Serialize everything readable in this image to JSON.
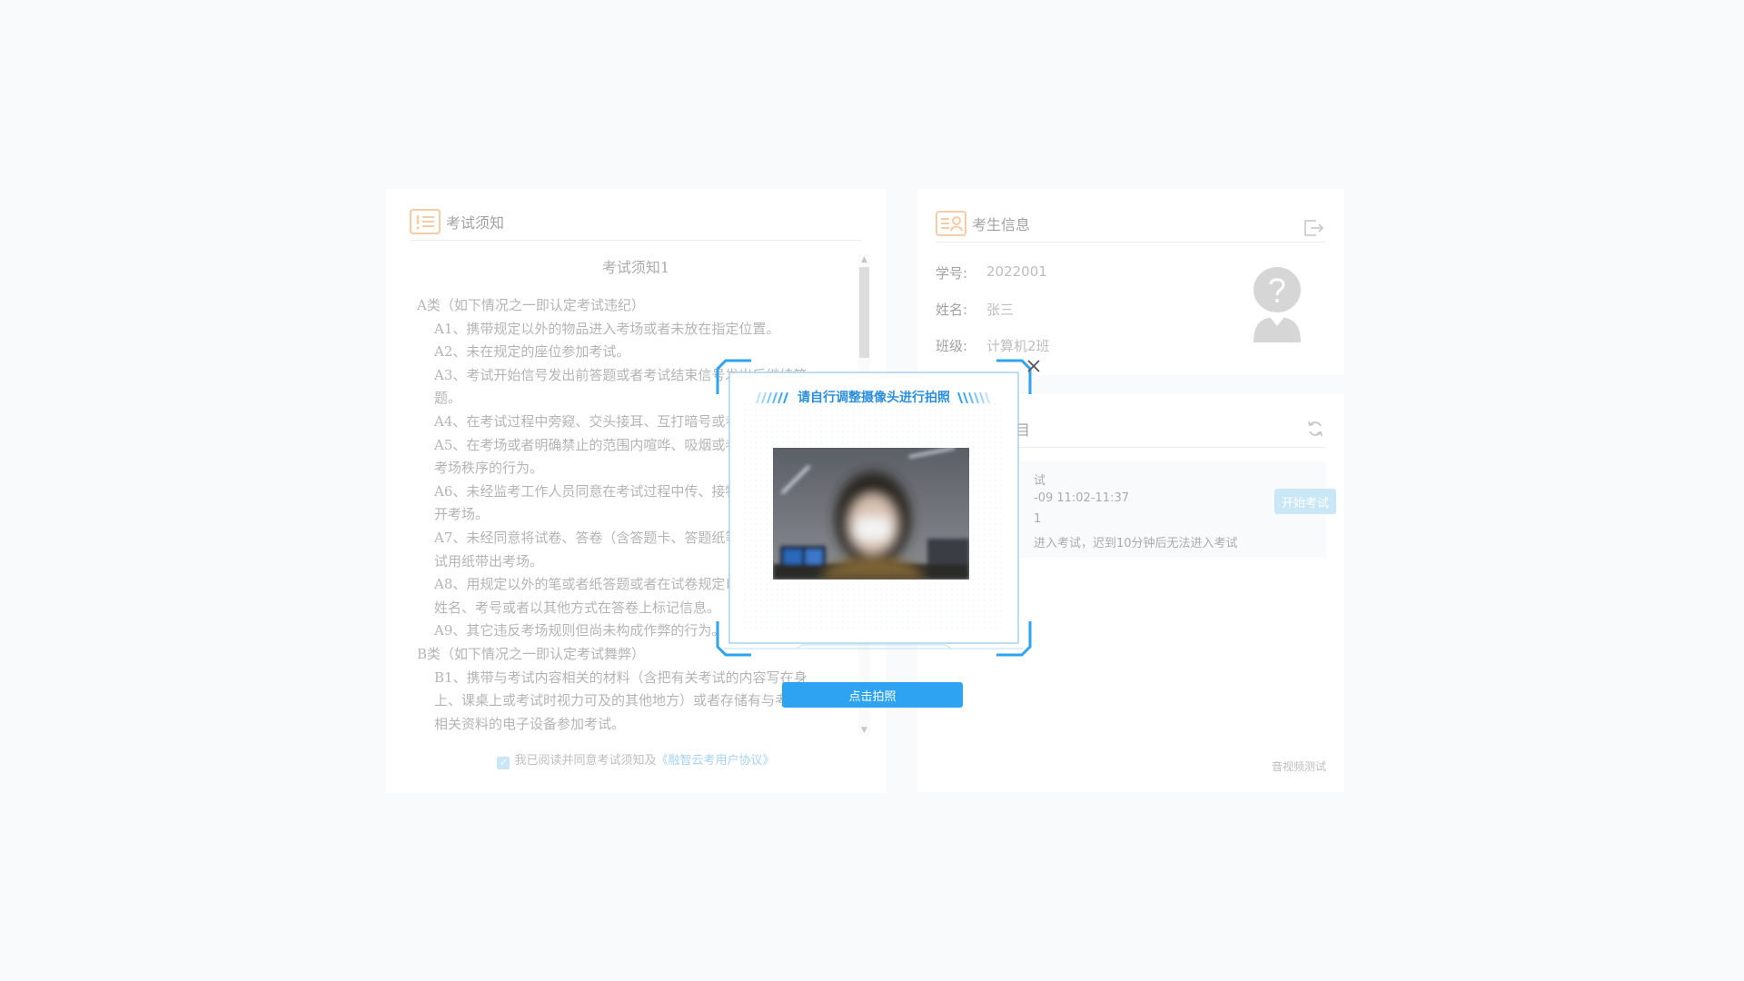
{
  "notice": {
    "header_title": "考试须知",
    "doc_title": "考试须知1",
    "lines": [
      {
        "kind": "cat",
        "text": "A类（如下情况之一即认定考试违纪）"
      },
      {
        "kind": "item",
        "text": "A1、携带规定以外的物品进入考场或者未放在指定位置。"
      },
      {
        "kind": "item",
        "text": "A2、未在规定的座位参加考试。"
      },
      {
        "kind": "item",
        "text": "A3、考试开始信号发出前答题或者考试结束信号发出后继续答题。"
      },
      {
        "kind": "item",
        "text": "A4、在考试过程中旁窥、交头接耳、互打暗号或者手势。"
      },
      {
        "kind": "item",
        "text": "A5、在考场或者明确禁止的范围内喧哗、吸烟或者实施其他影响考场秩序的行为。"
      },
      {
        "kind": "item",
        "text": "A6、未经监考工作人员同意在考试过程中传、接物品或者擅自离开考场。"
      },
      {
        "kind": "item",
        "text": "A7、未经同意将试卷、答卷（含答题卡、答题纸等）、草稿纸等考试用纸带出考场。"
      },
      {
        "kind": "item",
        "text": "A8、用规定以外的笔或者纸答题或者在试卷规定以外的地方书写姓名、考号或者以其他方式在答卷上标记信息。"
      },
      {
        "kind": "item",
        "text": "A9、其它违反考场规则但尚未构成作弊的行为。"
      },
      {
        "kind": "cat",
        "text": "B类（如下情况之一即认定考试舞弊）"
      },
      {
        "kind": "item",
        "text": "B1、携带与考试内容相关的材料（含把有关考试的内容写在身上、课桌上或考试时视力可及的其他地方）或者存储有与考试内容相关资料的电子设备参加考试。"
      }
    ],
    "agree_text": "我已阅读并同意考试须知及",
    "agree_link": "《融智云考用户协议》",
    "agree_checked": true
  },
  "student": {
    "header_title": "考生信息",
    "rows": [
      {
        "label": "学号:",
        "value": "2022001"
      },
      {
        "label": "姓名:",
        "value": "张三"
      },
      {
        "label": "班级:",
        "value": "计算机2班"
      }
    ]
  },
  "subjects": {
    "header_title": "考试科目",
    "exam": {
      "line1": "试",
      "line2": "-09 11:02-11:37",
      "line3": "1",
      "line4": "进入考试，迟到10分钟后无法进入考试",
      "start_label": "开始考试"
    },
    "av_test": "音视频测试"
  },
  "camera": {
    "title": "请自行调整摄像头进行拍照",
    "shoot_label": "点击拍照"
  },
  "icons": {
    "notice": "notice-list-icon",
    "student": "student-card-icon",
    "exit": "logout-icon",
    "refresh": "refresh-icon",
    "avatar": "unknown-avatar-icon",
    "close": "close-icon",
    "checkbox": "check-icon"
  },
  "colors": {
    "accent_orange": "#f0a05a",
    "accent_blue": "#2ea3f2",
    "light_blue": "#9fd3f0",
    "link": "#5eaee8"
  }
}
